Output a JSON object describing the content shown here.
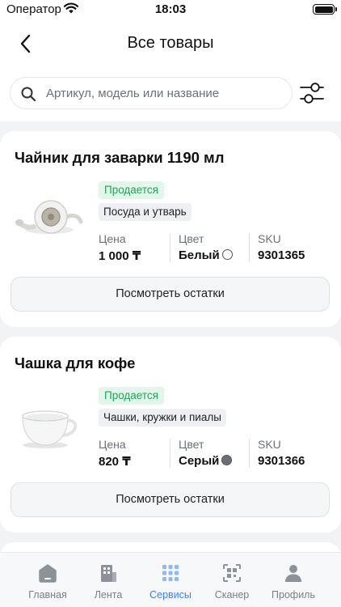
{
  "status_bar": {
    "carrier": "Оператор",
    "time": "18:03"
  },
  "header": {
    "title": "Все товары"
  },
  "search": {
    "placeholder": "Артикул, модель или название",
    "value": ""
  },
  "attribute_labels": {
    "price": "Цена",
    "color": "Цвет",
    "sku": "SKU"
  },
  "products": [
    {
      "name": "Чайник для заварки 1190 мл",
      "status": "Продается",
      "category": "Посуда и утварь",
      "price": "1 000 ₸",
      "color_name": "Белый",
      "color_hex": "#ffffff",
      "sku": "9301365",
      "stock_button": "Посмотреть остатки"
    },
    {
      "name": "Чашка для кофе",
      "status": "Продается",
      "category": "Чашки, кружки и пиалы",
      "price": "820 ₸",
      "color_name": "Серый",
      "color_hex": "#6b6e73",
      "sku": "9301366",
      "stock_button": "Посмотреть остатки"
    }
  ],
  "tab_bar": {
    "items": [
      {
        "label": "Главная",
        "icon": "home-icon",
        "active": false
      },
      {
        "label": "Лента",
        "icon": "feed-icon",
        "active": false
      },
      {
        "label": "Сервисы",
        "icon": "services-grid-icon",
        "active": true
      },
      {
        "label": "Сканер",
        "icon": "scanner-icon",
        "active": false
      },
      {
        "label": "Профиль",
        "icon": "profile-icon",
        "active": false
      }
    ]
  },
  "colors": {
    "accent": "#3b82f6",
    "status_green": "#1fa65a",
    "status_green_bg": "#e4f6eb",
    "page_bg": "#f1f3f5"
  }
}
